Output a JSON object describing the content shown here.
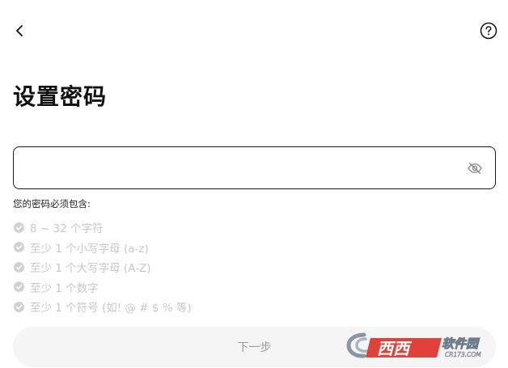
{
  "header": {
    "back_icon": "chevron-left-icon",
    "help_icon": "question-circle-icon"
  },
  "title": "设置密码",
  "password": {
    "value": "",
    "placeholder": "",
    "toggle_icon": "eye-off-icon"
  },
  "requirements": {
    "heading": "您的密码必须包含:",
    "items": [
      "8 ~ 32 个字符",
      "至少 1 个小写字母 (a-z)",
      "至少 1 个大写字母 (A-Z)",
      "至少 1 个数字",
      "至少 1 个符号 (如! @ # $ % 等)"
    ],
    "check_icon": "check-circle-icon",
    "muted_color": "#c7c7c7"
  },
  "next_button": {
    "label": "下一步"
  },
  "watermark": {
    "brand": "西西",
    "site": "软件园",
    "domain": "CR173.COM"
  }
}
